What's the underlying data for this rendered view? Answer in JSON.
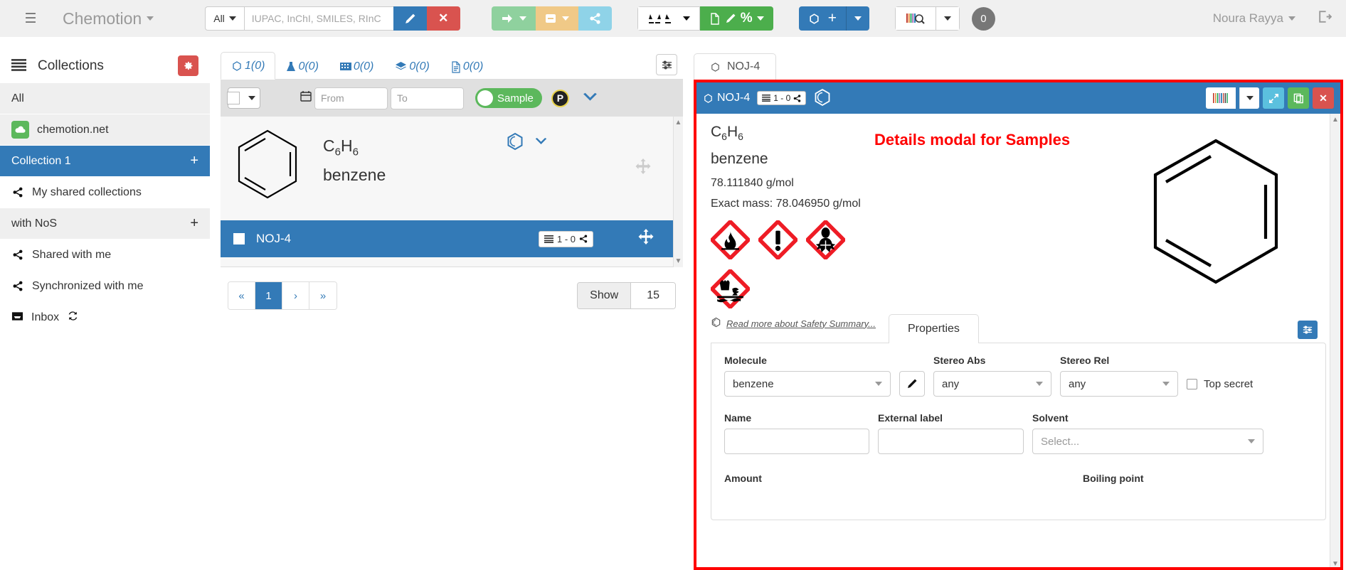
{
  "navbar": {
    "hamburger_icon": "list-icon",
    "brand": "Chemotion",
    "search_scope": "All",
    "search_placeholder": "IUPAC, InChI, SMILES, RInC",
    "search_value": "",
    "edit_icon": "pencil-icon",
    "clear_icon": "close-icon",
    "buttons": {
      "arrow_icon": "arrow-right-icon",
      "minus_icon": "minus-square-icon",
      "share_icon": "share-icon",
      "import_icon": "import-icon",
      "export_icon": "export-icon",
      "report_icon": "report-percent-icon",
      "hex_icon": "hexagon-icon",
      "plus_icon": "plus-icon",
      "scan_icon": "barcode-search-icon"
    },
    "counter": "0",
    "user": "Noura Rayya",
    "logout_icon": "sign-out-icon"
  },
  "sidebar": {
    "title": "Collections",
    "title_icon": "list-icon",
    "gear_icon": "gear-icon",
    "items": [
      {
        "label": "All",
        "icon": "",
        "style": "alt",
        "plus": false
      },
      {
        "label": "chemotion.net",
        "icon": "cloud-icon",
        "style": "alt",
        "plus": false
      },
      {
        "label": "Collection 1",
        "icon": "",
        "style": "active",
        "plus": true
      },
      {
        "label": "My shared collections",
        "icon": "share-icon",
        "style": "plain",
        "plus": false
      },
      {
        "label": "with  NoS",
        "icon": "",
        "style": "alt",
        "plus": true
      },
      {
        "label": "Shared with me",
        "icon": "share-icon",
        "style": "plain",
        "plus": false
      },
      {
        "label": "Synchronized with me",
        "icon": "share-icon",
        "style": "plain",
        "plus": false
      }
    ],
    "inbox": {
      "label": "Inbox",
      "icon": "inbox-icon",
      "refresh_icon": "refresh-icon"
    }
  },
  "middle": {
    "tabs": [
      {
        "label": "1(0)",
        "icon": "hexagon-icon",
        "active": true
      },
      {
        "label": "0(0)",
        "icon": "flask-icon",
        "active": false
      },
      {
        "label": "0(0)",
        "icon": "grid-icon",
        "active": false
      },
      {
        "label": "0(0)",
        "icon": "layers-icon",
        "active": false
      },
      {
        "label": "0(0)",
        "icon": "document-icon",
        "active": false
      }
    ],
    "filter_icon": "sliders-icon",
    "toolbar": {
      "select_icon": "checkbox-dropdown",
      "calendar_icon": "calendar-icon",
      "from_placeholder": "From",
      "from_value": "",
      "to_placeholder": "To",
      "to_value": "",
      "toggle_label": "Sample",
      "p_badge": "P",
      "chevron_icon": "chevron-down-icon"
    },
    "sample": {
      "formula_prefix": "C",
      "formula": "C6H6",
      "name": "benzene",
      "hex_icon": "hexagon-icon",
      "chevron_icon": "chevron-down-icon",
      "move_icon": "move-icon"
    },
    "selected_row": {
      "label": "NOJ-4",
      "chip": "1 - 0",
      "chip_icon": "list-icon",
      "share_icon": "share-icon",
      "move_icon": "move-icon"
    },
    "pager": {
      "first": "«",
      "prev_hidden": "",
      "page": "1",
      "next": "›",
      "last": "»",
      "show_label": "Show",
      "show_value": "15"
    }
  },
  "detail": {
    "tab": {
      "label": "NOJ-4",
      "icon": "hexagon-icon"
    },
    "header": {
      "title": "NOJ-4",
      "title_icon": "hexagon-icon",
      "chip": "1 - 0",
      "chip_icon": "list-icon",
      "share_icon": "share-icon",
      "molecule_icon": "hexagon-outline-icon",
      "barcode_icon": "barcode-icon",
      "caret_icon": "chevron-down-icon",
      "expand_icon": "expand-icon",
      "copy_icon": "copy-icon",
      "close_icon": "close-icon"
    },
    "info": {
      "formula": "C6H6",
      "name": "benzene",
      "molecular_weight": "78.111840 g/mol",
      "exact_mass": "Exact mass: 78.046950 g/mol",
      "annotation": "Details modal for Samples"
    },
    "ghs": [
      {
        "name": "flame-pictogram"
      },
      {
        "name": "exclamation-pictogram"
      },
      {
        "name": "health-hazard-pictogram"
      },
      {
        "name": "environment-pictogram"
      }
    ],
    "safety_link": "Read more about Safety Summary...",
    "safety_link_icon": "hexagon-outline-icon",
    "tabs": [
      {
        "label": "Properties",
        "active": true
      }
    ],
    "panel_gear_icon": "sliders-icon",
    "form": {
      "molecule_label": "Molecule",
      "molecule_value": "benzene",
      "molecule_edit_icon": "pencil-icon",
      "stereo_abs_label": "Stereo Abs",
      "stereo_abs_value": "any",
      "stereo_rel_label": "Stereo Rel",
      "stereo_rel_value": "any",
      "top_secret_label": "Top secret",
      "name_label": "Name",
      "name_value": "",
      "external_label_label": "External label",
      "external_label_value": "",
      "solvent_label": "Solvent",
      "solvent_placeholder": "Select...",
      "amount_label": "Amount",
      "boiling_point_label": "Boiling point"
    }
  },
  "colors": {
    "primary": "#337ab7",
    "danger": "#d9534f",
    "success": "#5cb85c",
    "annotation_red": "#ff0000"
  }
}
